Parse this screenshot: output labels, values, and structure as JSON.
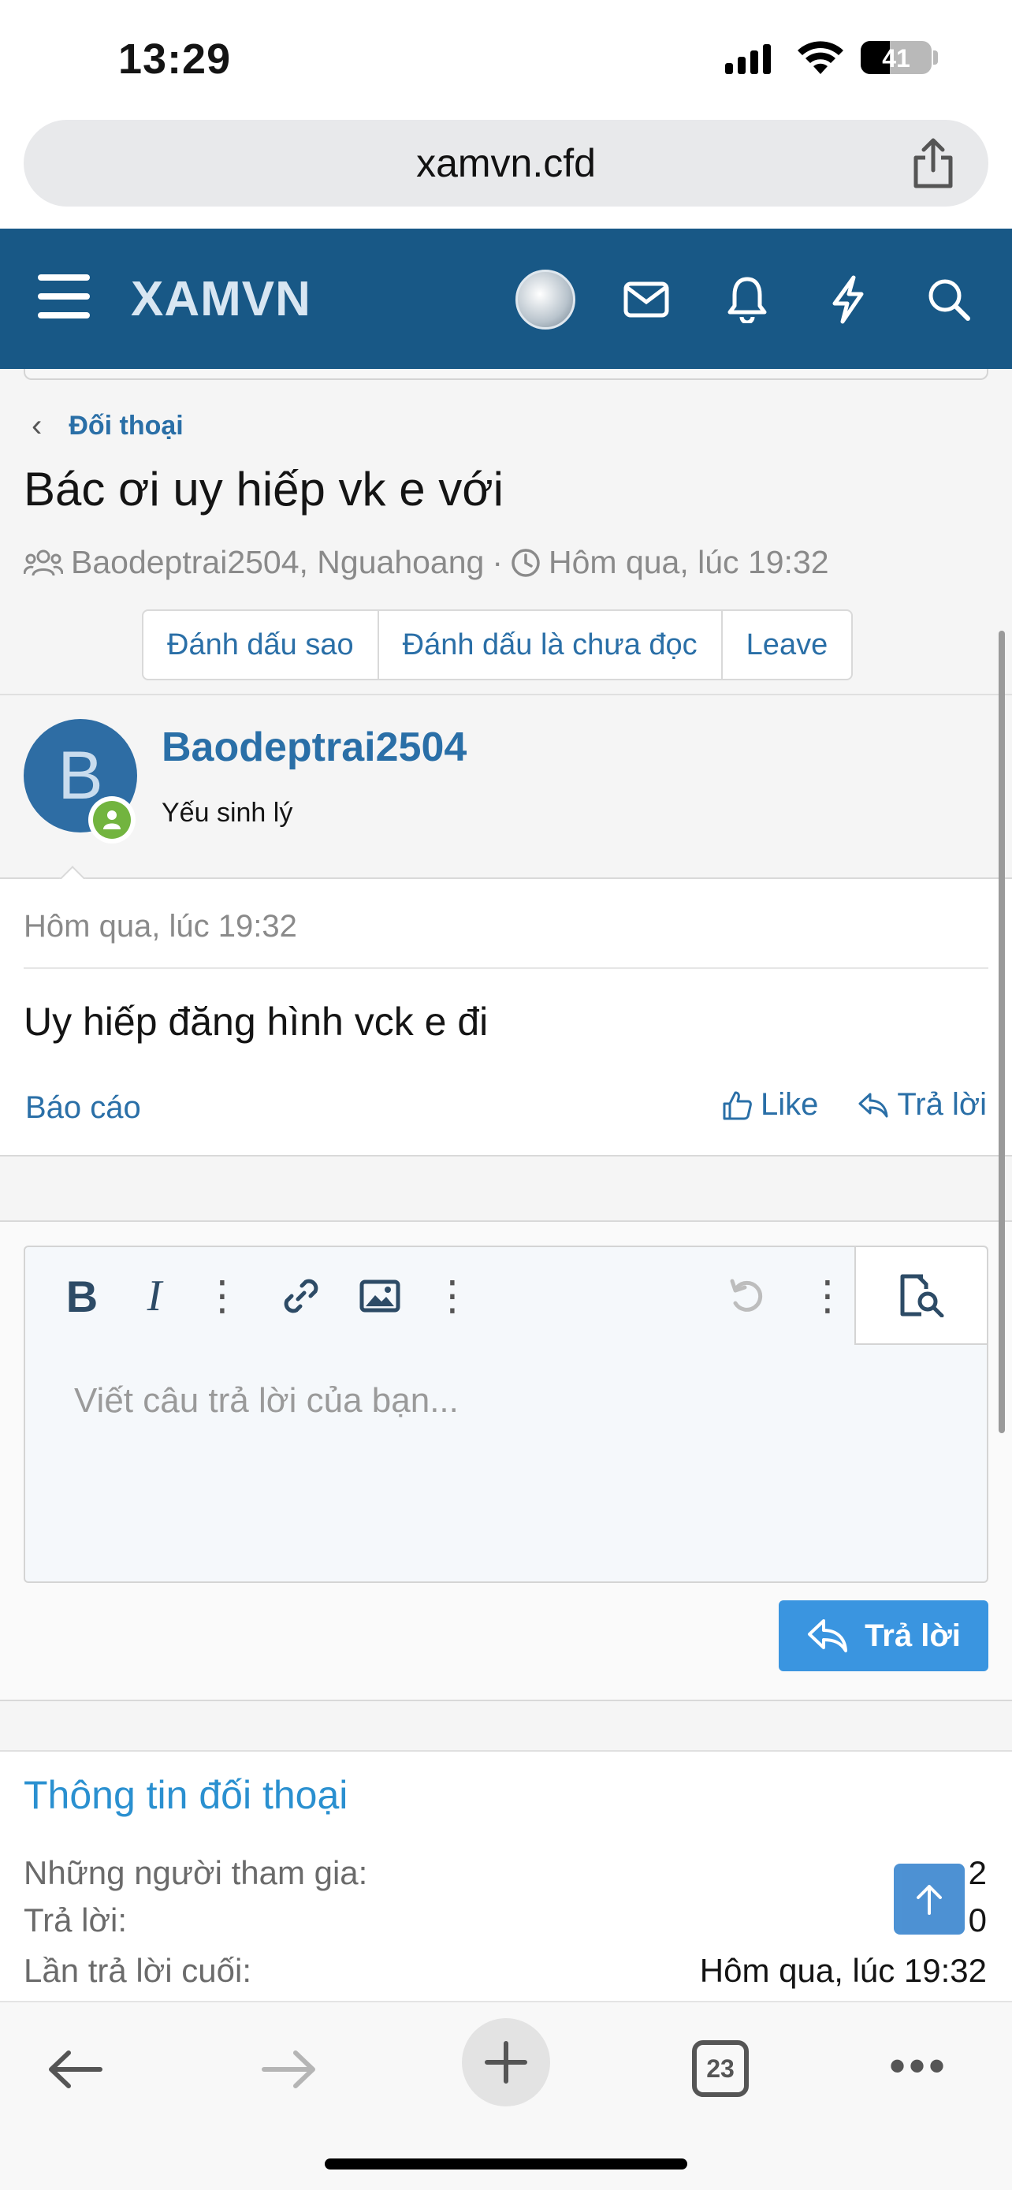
{
  "status_bar": {
    "time": "13:29",
    "battery": "41"
  },
  "browser": {
    "url": "xamvn.cfd",
    "tab_count": "23"
  },
  "site": {
    "logo": "XAMVN"
  },
  "breadcrumb": {
    "label": "Đối thoại"
  },
  "conversation": {
    "title": "Bác ơi uy hiếp vk e với",
    "participants": "Baodeptrai2504, Nguahoang",
    "separator": "·",
    "started": "Hôm qua, lúc 19:32",
    "buttons": {
      "star": "Đánh dấu sao",
      "mark_unread": "Đánh dấu là chưa đọc",
      "leave": "Leave"
    }
  },
  "message": {
    "avatar_letter": "B",
    "author": "Baodeptrai2504",
    "user_title": "Yếu sinh lý",
    "date": "Hôm qua, lúc 19:32",
    "body": "Uy hiếp đăng hình vck e đi",
    "report": "Báo cáo",
    "like": "Like",
    "reply": "Trả lời"
  },
  "editor": {
    "placeholder": "Viết câu trả lời của bạn...",
    "submit": "Trả lời"
  },
  "info": {
    "title": "Thông tin đối thoại",
    "rows": [
      {
        "label": "Những người tham gia:",
        "value": "2"
      },
      {
        "label": "Trả lời:",
        "value": "0"
      },
      {
        "label": "Lần trả lời cuối:",
        "value": "Hôm qua, lúc 19:32"
      }
    ]
  },
  "colors": {
    "header": "#185886",
    "link": "#2a6fa7",
    "button": "#3a95e0",
    "online": "#72b43f"
  }
}
